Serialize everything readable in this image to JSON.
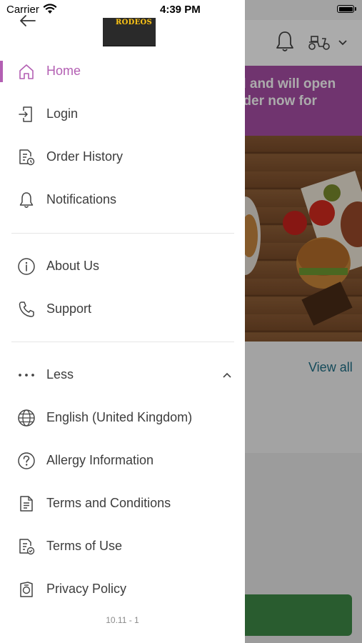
{
  "status_bar": {
    "carrier": "Carrier",
    "time": "4:39 PM"
  },
  "brand": {
    "logo_text": "RODEOS",
    "accent_color": "#b35fb3"
  },
  "menu": {
    "primary": [
      {
        "label": "Home",
        "icon": "home-icon",
        "active": true
      },
      {
        "label": "Login",
        "icon": "login-icon"
      },
      {
        "label": "Order History",
        "icon": "order-history-icon"
      },
      {
        "label": "Notifications",
        "icon": "bell-icon"
      }
    ],
    "secondary": [
      {
        "label": "About Us",
        "icon": "info-icon"
      },
      {
        "label": "Support",
        "icon": "phone-icon"
      }
    ],
    "less_label": "Less",
    "more": [
      {
        "label": "English (United Kingdom)",
        "icon": "globe-icon"
      },
      {
        "label": "Allergy Information",
        "icon": "question-icon"
      },
      {
        "label": "Terms and Conditions",
        "icon": "document-icon"
      },
      {
        "label": "Terms of Use",
        "icon": "terms-check-icon"
      },
      {
        "label": "Privacy Policy",
        "icon": "privacy-icon"
      }
    ]
  },
  "version": "10.11 - 1",
  "background_app": {
    "banner_text_line1": "d and will open",
    "banner_text_line2": "rder now for",
    "view_all": "View all",
    "banner_color": "#a84ea6",
    "button_color": "#3e8a46"
  }
}
